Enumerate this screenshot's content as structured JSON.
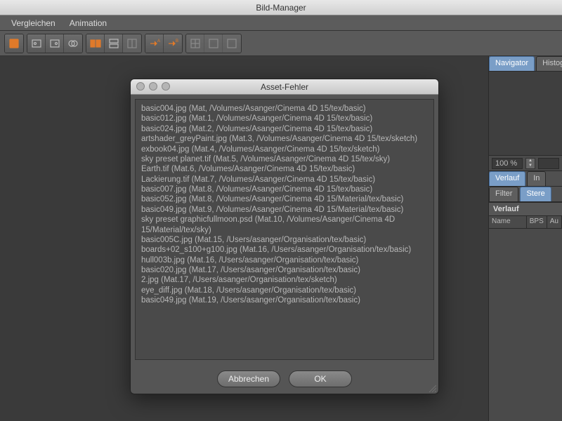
{
  "window": {
    "title": "Bild-Manager"
  },
  "menu": {
    "items": [
      "Vergleichen",
      "Animation"
    ]
  },
  "toolbar_icons": [
    "notebook-icon",
    "page-a-icon",
    "page-b-icon",
    "circle-compare-icon",
    "compare-ab-icon",
    "compare-stacked-icon",
    "compare-split-icon",
    "arrow-a-icon",
    "arrow-b-icon",
    "grid-scale-icon",
    "grid-a-icon",
    "grid-b-icon"
  ],
  "right": {
    "tabs1": [
      {
        "label": "Navigator",
        "active": true
      },
      {
        "label": "Histog",
        "active": false
      }
    ],
    "zoom": "100 %",
    "tabs2": [
      {
        "label": "Verlauf",
        "active": true
      },
      {
        "label": "In",
        "active": false
      }
    ],
    "tabs3": [
      {
        "label": "Filter",
        "active": false
      },
      {
        "label": "Stere",
        "active": true
      }
    ],
    "section": "Verlauf",
    "cols": [
      "Name",
      "BPS",
      "Au"
    ]
  },
  "dialog": {
    "title": "Asset-Fehler",
    "lines": [
      "basic004.jpg (Mat, /Volumes/Asanger/Cinema 4D 15/tex/basic)",
      "basic012.jpg (Mat.1, /Volumes/Asanger/Cinema 4D 15/tex/basic)",
      "basic024.jpg (Mat.2, /Volumes/Asanger/Cinema 4D 15/tex/basic)",
      "artshader_greyPaint.jpg (Mat.3, /Volumes/Asanger/Cinema 4D 15/tex/sketch)",
      "exbook04.jpg (Mat.4, /Volumes/Asanger/Cinema 4D 15/tex/sketch)",
      "sky preset planet.tif (Mat.5, /Volumes/Asanger/Cinema 4D 15/tex/sky)",
      "Earth.tif (Mat.6, /Volumes/Asanger/Cinema 4D 15/tex/basic)",
      "Lackierung.tif (Mat.7, /Volumes/Asanger/Cinema 4D 15/tex/basic)",
      "basic007.jpg (Mat.8, /Volumes/Asanger/Cinema 4D 15/tex/basic)",
      "basic052.jpg (Mat.8, /Volumes/Asanger/Cinema 4D 15/Material/tex/basic)",
      "basic049.jpg (Mat.9, /Volumes/Asanger/Cinema 4D 15/Material/tex/basic)",
      "sky preset graphicfullmoon.psd (Mat.10, /Volumes/Asanger/Cinema 4D 15/Material/tex/sky)",
      "basic005C.jpg (Mat.15, /Users/asanger/Organisation/tex/basic)",
      "boards+02_s100+g100.jpg (Mat.16, /Users/asanger/Organisation/tex/basic)",
      "hull003b.jpg (Mat.16, /Users/asanger/Organisation/tex/basic)",
      "basic020.jpg (Mat.17, /Users/asanger/Organisation/tex/basic)",
      "2.jpg (Mat.17, /Users/asanger/Organisation/tex/sketch)",
      "eye_diff.jpg (Mat.18, /Users/asanger/Organisation/tex/basic)",
      "basic049.jpg (Mat.19, /Users/asanger/Organisation/tex/basic)"
    ],
    "buttons": {
      "cancel": "Abbrechen",
      "ok": "OK"
    }
  }
}
